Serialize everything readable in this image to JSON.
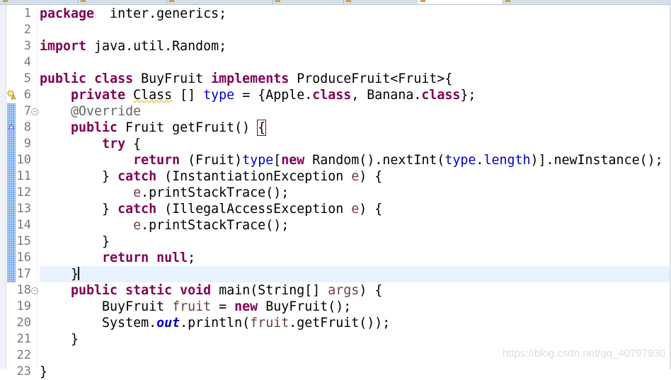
{
  "editor": {
    "current_line": 17,
    "lines": [
      {
        "n": "1",
        "tokens": [
          [
            "k",
            "package"
          ],
          [
            "",
            "  inter.generics;"
          ]
        ]
      },
      {
        "n": "2",
        "tokens": []
      },
      {
        "n": "3",
        "tokens": [
          [
            "k",
            "import"
          ],
          [
            "",
            " java.util.Random;"
          ]
        ]
      },
      {
        "n": "4",
        "tokens": []
      },
      {
        "n": "5",
        "tokens": [
          [
            "k",
            "public"
          ],
          [
            "",
            " "
          ],
          [
            "k",
            "class"
          ],
          [
            "",
            " BuyFruit "
          ],
          [
            "k",
            "implements"
          ],
          [
            "",
            " ProduceFruit<Fruit>{"
          ]
        ]
      },
      {
        "n": "6",
        "marker": "warning-icon",
        "tokens": [
          [
            "",
            "    "
          ],
          [
            "k",
            "private"
          ],
          [
            "",
            " "
          ],
          [
            "w",
            "Class"
          ],
          [
            "",
            " [] "
          ],
          [
            "f",
            "type"
          ],
          [
            "",
            " = {Apple."
          ],
          [
            "k",
            "class"
          ],
          [
            ", Banana."
          ],
          [
            "k",
            "class"
          ],
          [
            "",
            "};"
          ]
        ]
      },
      {
        "n": "7",
        "fold": true,
        "tokens": [
          [
            "",
            "    "
          ],
          [
            "a",
            "@Override"
          ]
        ]
      },
      {
        "n": "8",
        "marker": "override-icon",
        "tokens": [
          [
            "",
            "    "
          ],
          [
            "k",
            "public"
          ],
          [
            "",
            " Fruit getFruit() "
          ],
          [
            "bm",
            "{"
          ]
        ]
      },
      {
        "n": "9",
        "tokens": [
          [
            "",
            "        "
          ],
          [
            "k",
            "try"
          ],
          [
            "",
            " {"
          ]
        ]
      },
      {
        "n": "10",
        "tokens": [
          [
            "",
            "            "
          ],
          [
            "k",
            "return"
          ],
          [
            "",
            " (Fruit)"
          ],
          [
            "f",
            "type"
          ],
          [
            "",
            "["
          ],
          [
            "k",
            "new"
          ],
          [
            "",
            " Random().nextInt("
          ],
          [
            "f",
            "type"
          ],
          [
            "",
            "."
          ],
          [
            "f",
            "length"
          ],
          [
            "",
            ")].newInstance();"
          ]
        ]
      },
      {
        "n": "11",
        "tokens": [
          [
            "",
            "        } "
          ],
          [
            "k",
            "catch"
          ],
          [
            "",
            " (InstantiationException "
          ],
          [
            "l",
            "e"
          ],
          [
            "",
            ") {"
          ]
        ]
      },
      {
        "n": "12",
        "tokens": [
          [
            "",
            "            "
          ],
          [
            "l",
            "e"
          ],
          [
            "",
            ".printStackTrace();"
          ]
        ]
      },
      {
        "n": "13",
        "tokens": [
          [
            "",
            "        } "
          ],
          [
            "k",
            "catch"
          ],
          [
            "",
            " (IllegalAccessException "
          ],
          [
            "l",
            "e"
          ],
          [
            "",
            ") {"
          ]
        ]
      },
      {
        "n": "14",
        "tokens": [
          [
            "",
            "            "
          ],
          [
            "l",
            "e"
          ],
          [
            "",
            ".printStackTrace();"
          ]
        ]
      },
      {
        "n": "15",
        "tokens": [
          [
            "",
            "        }"
          ]
        ]
      },
      {
        "n": "16",
        "tokens": [
          [
            "",
            "        "
          ],
          [
            "k",
            "return"
          ],
          [
            "",
            " "
          ],
          [
            "k",
            "null"
          ],
          [
            "",
            ";"
          ]
        ]
      },
      {
        "n": "17",
        "tokens": [
          [
            "",
            "    }"
          ]
        ]
      },
      {
        "n": "18",
        "fold": true,
        "tokens": [
          [
            "",
            "    "
          ],
          [
            "k",
            "public"
          ],
          [
            "",
            " "
          ],
          [
            "k",
            "static"
          ],
          [
            "",
            " "
          ],
          [
            "k",
            "void"
          ],
          [
            "",
            " main(String[] "
          ],
          [
            "l",
            "args"
          ],
          [
            "",
            ") {"
          ]
        ]
      },
      {
        "n": "19",
        "tokens": [
          [
            "",
            "        BuyFruit "
          ],
          [
            "l",
            "fruit"
          ],
          [
            "",
            " = "
          ],
          [
            "k",
            "new"
          ],
          [
            "",
            " BuyFruit();"
          ]
        ]
      },
      {
        "n": "20",
        "tokens": [
          [
            "",
            "        System."
          ],
          [
            "s",
            "out"
          ],
          [
            "",
            ".println("
          ],
          [
            "l",
            "fruit"
          ],
          [
            "",
            ".getFruit());"
          ]
        ]
      },
      {
        "n": "21",
        "tokens": [
          [
            "",
            "    }"
          ]
        ]
      },
      {
        "n": "22",
        "tokens": []
      },
      {
        "n": "23",
        "tokens": [
          [
            "",
            "}"
          ]
        ]
      }
    ]
  },
  "watermark": "https://blog.csdn.net/qq_40797930"
}
